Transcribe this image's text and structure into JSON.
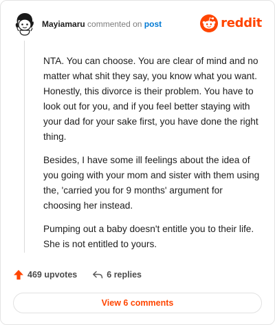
{
  "comment": {
    "author": "Mayiamaru",
    "action_text": "commented on",
    "post_link": "post",
    "avatar_icon": "snoo-avatar-icon",
    "paragraphs": [
      "NTA. You can choose. You are clear of mind and no matter what shit they say, you know what you want. Honestly, this divorce is their problem. You have to look out for you, and if you feel better staying with your dad for your sake first, you have done the right thing.",
      "Besides, I have some ill feelings about the idea of you going with your mom and sister with them using the, 'carried you for 9 months' argument for choosing her instead.",
      "Pumping out a baby doesn't entitle you to their life. She is not entitled to yours."
    ]
  },
  "brand": {
    "wordmark": "reddit",
    "icon": "reddit-logo-icon",
    "color": "#ff4500"
  },
  "actions": {
    "upvotes_label": "469 upvotes",
    "upvote_icon": "upvote-arrow-icon",
    "replies_label": "6 replies",
    "reply_icon": "reply-arrow-icon"
  },
  "footer": {
    "view_comments_label": "View 6 comments",
    "accent": "#ff4500"
  }
}
